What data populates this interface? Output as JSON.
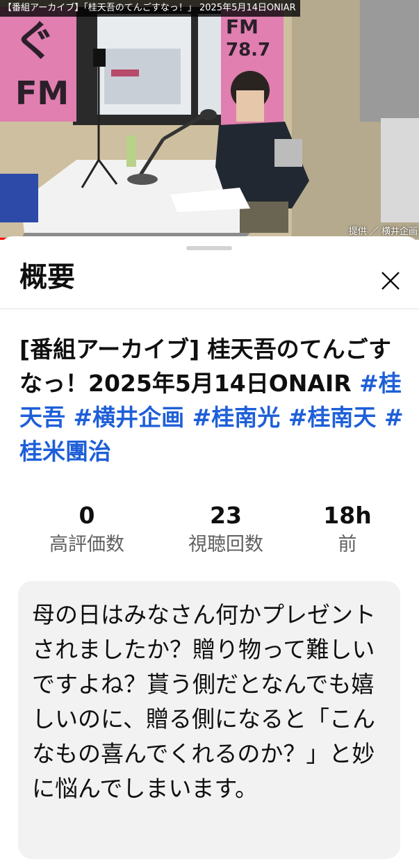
{
  "video": {
    "title_overlay": "【番組アーカイブ】「桂天吾のてんごすなっ！」 2025年5月14日ONIAR",
    "credit": "提供 ／ 横井企画",
    "sign_fm_station": "FM 78.7",
    "sign_radio_station": "ぐっFM",
    "progress_fraction": 0.2
  },
  "panel": {
    "title": "概要",
    "close_icon": "close-icon"
  },
  "details": {
    "heading_text": "[番組アーカイブ] 桂天吾のてんごすなっ！2025年5月14日ONAIR",
    "hashtags": [
      "#桂天吾",
      "#横井企画",
      "#桂南光",
      "#桂南天",
      "#桂米團治"
    ]
  },
  "stats": [
    {
      "value": "0",
      "label": "高評価数"
    },
    {
      "value": "23",
      "label": "視聴回数"
    },
    {
      "value": "18h",
      "label": "前"
    }
  ],
  "description": {
    "text": "母の日はみなさん何かプレゼントされましたか？贈り物って難しいですよね？貰う側だとなんでも嬉しいのに、贈る側になると「こんなもの喜んでくれるのか？」と妙に悩んでしまいます。"
  },
  "colors": {
    "hashtag": "#1e5fd8",
    "progress": "#ff0000",
    "description_bg": "#f2f2f2"
  }
}
